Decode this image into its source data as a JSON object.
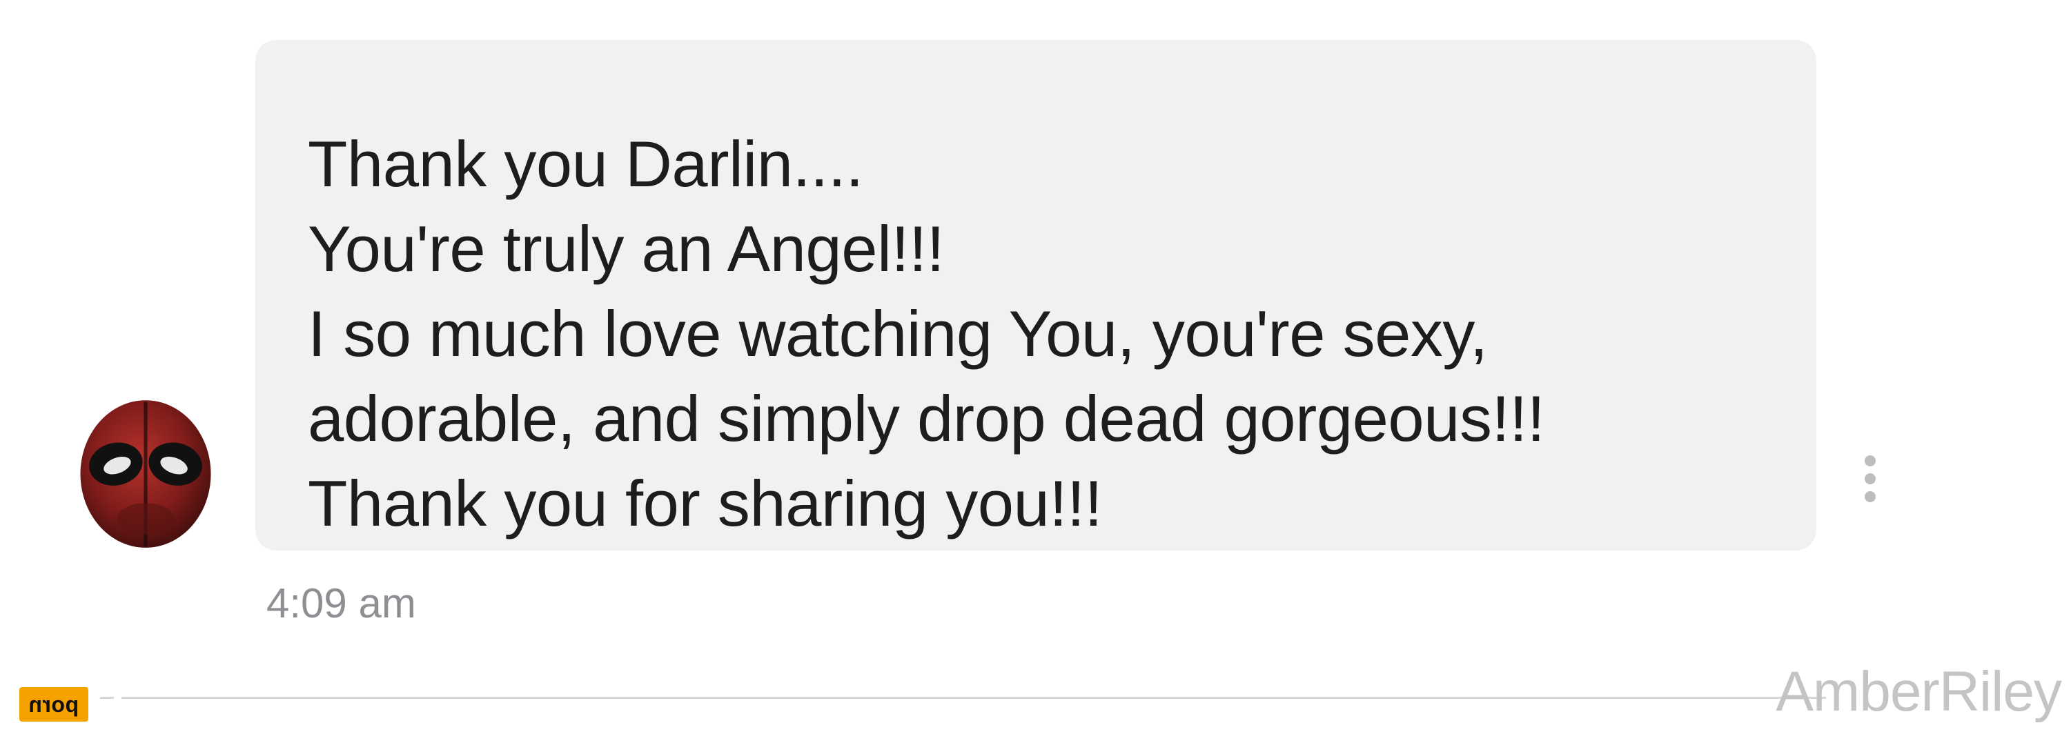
{
  "message": {
    "lines": [
      "Thank you Darlin....",
      "You're truly an Angel!!!",
      "I so much love watching You, you're sexy,",
      "adorable, and simply drop dead gorgeous!!!",
      "Thank you for sharing you!!!"
    ],
    "timestamp": "4:09 am"
  },
  "icons": {
    "avatar": "masked-hero-avatar",
    "more": "more-vertical-icon"
  },
  "colors": {
    "bubble": "#f0f1f3",
    "text": "#1d1d1d",
    "timestamp": "#8d8f93",
    "badge": "#f5a100",
    "watermark": "#c4c4c4"
  },
  "footer": {
    "badge_text": "porn",
    "watermark": "AmberRiley"
  }
}
